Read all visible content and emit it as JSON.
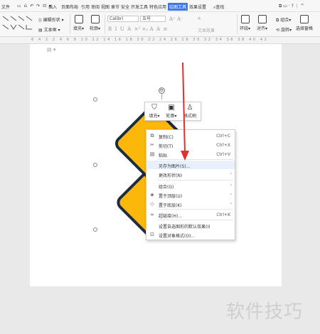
{
  "menubar": {
    "file": "文件",
    "tabs": [
      "插入",
      "页面布局",
      "引用",
      "审阅",
      "视图",
      "章节",
      "安全",
      "开发工具",
      "特色应用"
    ],
    "active_tab": "绘图工具",
    "next_tab": "效果设置",
    "search": "查找"
  },
  "ribbon": {
    "edit_shape": "编辑形状",
    "text_box": "文本框",
    "fill": "填充",
    "outline": "轮廓",
    "font_name": "Calibri",
    "font_size": "五号",
    "text_effect": "文本效果",
    "wrap": "环绕",
    "align": "对齐",
    "group": "组合",
    "rotate": "旋转",
    "select_pane": "选择窗格"
  },
  "ruler": {
    "numbers": "6 4 2 2 4 6 8 10 12 14 16 18 20 22 24 26 28 30 32 34 36 38 40 42"
  },
  "minibar": {
    "fill": "填充",
    "outline": "轮廓",
    "format_painter": "格式刷"
  },
  "context_menu": {
    "items": [
      {
        "icon": "copy-icon",
        "label": "复制(C)",
        "shortcut": "Ctrl+C"
      },
      {
        "icon": "cut-icon",
        "label": "剪切(T)",
        "shortcut": "Ctrl+X"
      },
      {
        "icon": "paste-icon",
        "label": "粘贴",
        "shortcut": "Ctrl+V"
      },
      {
        "icon": "",
        "label": "另存为图片(S)...",
        "shortcut": ""
      },
      {
        "icon": "",
        "label": "更改形状(N)",
        "shortcut": ""
      },
      {
        "icon": "",
        "label": "组合(G)",
        "shortcut": ""
      },
      {
        "icon": "bring-to-front-icon",
        "label": "置于顶层(U)",
        "shortcut": ""
      },
      {
        "icon": "send-to-back-icon",
        "label": "置于底层(K)",
        "shortcut": ""
      },
      {
        "icon": "link-icon",
        "label": "超链接(H)...",
        "shortcut": "Ctrl+K"
      },
      {
        "icon": "",
        "label": "设置自选图形的默认效果(I)",
        "shortcut": ""
      },
      {
        "icon": "format-object-icon",
        "label": "设置对象格式(O)...",
        "shortcut": ""
      }
    ]
  },
  "colors": {
    "accent": "#3d78e8",
    "shape_fill": "#fcb70b",
    "shape_stroke": "#1d2b3c",
    "arrow": "#e03030"
  },
  "watermark": "软件技巧"
}
